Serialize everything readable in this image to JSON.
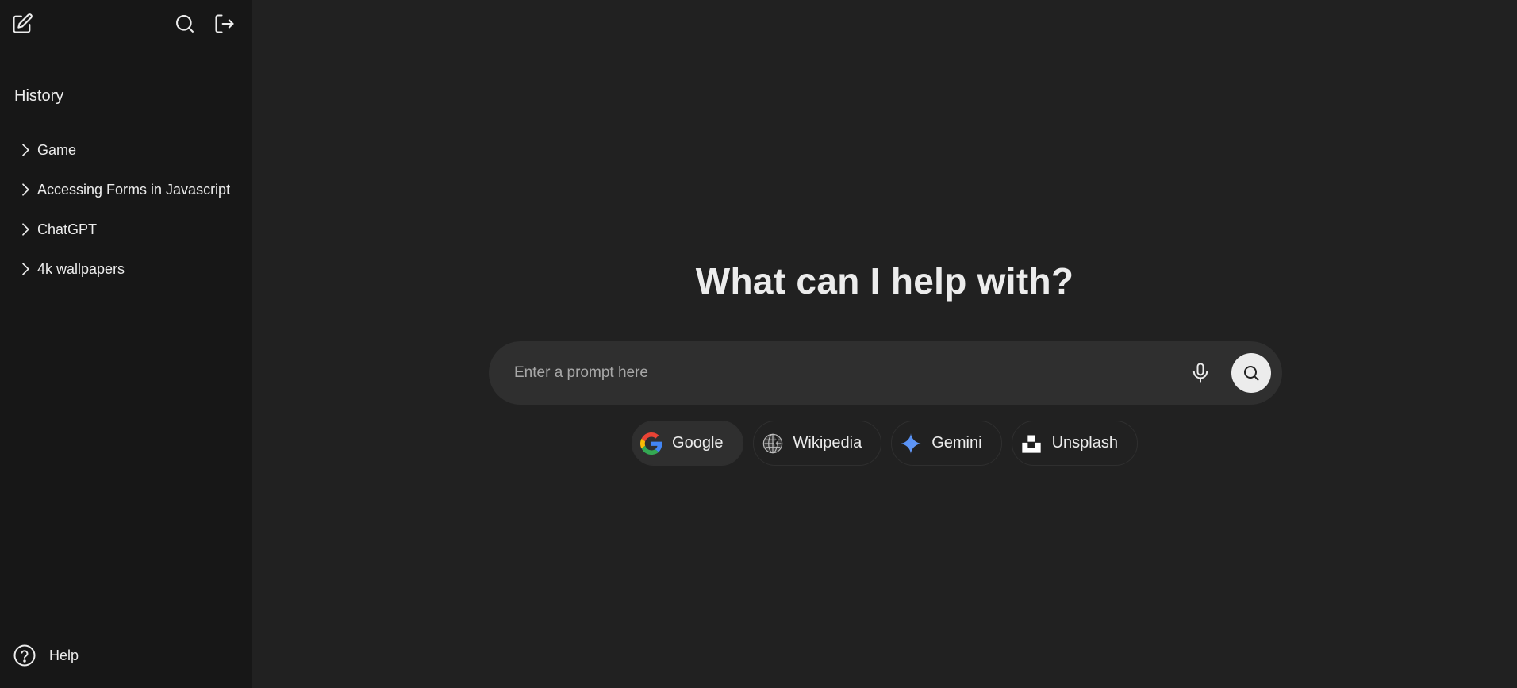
{
  "sidebar": {
    "new_chat_icon": "edit-icon",
    "search_icon": "search-icon",
    "logout_icon": "logout-icon",
    "history_title": "History",
    "history_items": [
      {
        "label": "Game"
      },
      {
        "label": "Accessing Forms in Javascript"
      },
      {
        "label": "ChatGPT"
      },
      {
        "label": "4k wallpapers"
      }
    ],
    "help_label": "Help"
  },
  "main": {
    "heading": "What can I help with?",
    "prompt": {
      "placeholder": "Enter a prompt here",
      "value": ""
    },
    "engines": [
      {
        "label": "Google",
        "active": true
      },
      {
        "label": "Wikipedia",
        "active": false
      },
      {
        "label": "Gemini",
        "active": false
      },
      {
        "label": "Unsplash",
        "active": false
      }
    ]
  },
  "colors": {
    "background": "#212121",
    "sidebar": "#171717",
    "surface": "#2f2f2f",
    "text": "#ececec",
    "placeholder": "#a8a8a8",
    "gemini_blue": "#4f8df5"
  }
}
